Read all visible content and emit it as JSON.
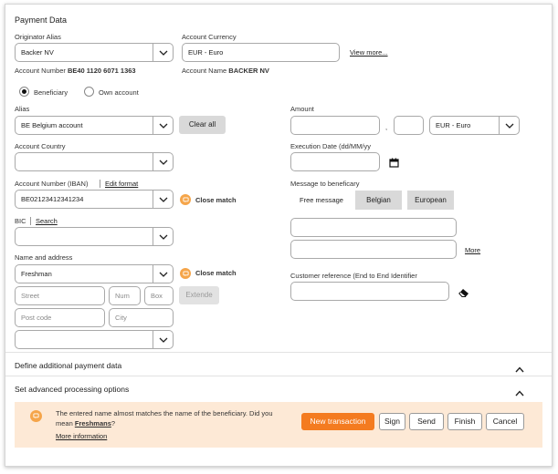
{
  "title": "Payment Data",
  "originator": {
    "alias_label": "Originator Alias",
    "alias_value": "Backer NV",
    "account_number_label": "Account Number",
    "account_number_value": "BE40 1120 6071 1363",
    "currency_label": "Account Currency",
    "currency_value": "EUR - Euro",
    "view_more": "View more...",
    "account_name_label": "Account Name",
    "account_name_value": "BACKER NV"
  },
  "beneficiary_type": {
    "option_beneficiary": "Beneficiary",
    "option_own": "Own account",
    "selected": "Beneficiary"
  },
  "left": {
    "alias_label": "Alias",
    "alias_value": "BE Belgium account",
    "clear_all": "Clear all",
    "country_label": "Account Country",
    "country_value": "",
    "iban_label": "Account Number (IBAN)",
    "edit_format": "Edit format",
    "iban_value": "BE02123412341234",
    "close_match": "Close match",
    "bic_label": "BIC",
    "bic_search": "Search",
    "bic_value": "",
    "name_label": "Name and address",
    "name_value": "Freshman",
    "close_match2": "Close match",
    "street_ph": "Street",
    "num_ph": "Num",
    "box_ph": "Box",
    "extend": "Extende",
    "postcode_ph": "Post code",
    "city_ph": "City",
    "country2_value": ""
  },
  "right": {
    "amount_label": "Amount",
    "amount_sep": ",",
    "currency_value": "EUR - Euro",
    "exec_label": "Execution Date (dd/MM/yy",
    "message_label": "Message to beneficary",
    "tab_free": "Free message",
    "tab_belgian": "Belgian",
    "tab_european": "European",
    "more": "More",
    "customer_ref_label": "Customer reference (End to End Identifier"
  },
  "sections": {
    "additional": "Define additional payment data",
    "advanced": "Set advanced processing options"
  },
  "notice": {
    "text1": "The entered name almost matches the name of the beneficiary. Did you",
    "text2_pre": "mean ",
    "text2_name": "Freshmans",
    "text2_post": "?",
    "more_info": "More information",
    "new_transaction": "New transaction",
    "sign": "Sign",
    "send": "Send",
    "finish": "Finish",
    "cancel": "Cancel"
  },
  "colors": {
    "accent": "#f47b20",
    "notice_bg": "#fde9d6",
    "warning": "#f5a54a",
    "grey_button": "#d9d9d9"
  }
}
